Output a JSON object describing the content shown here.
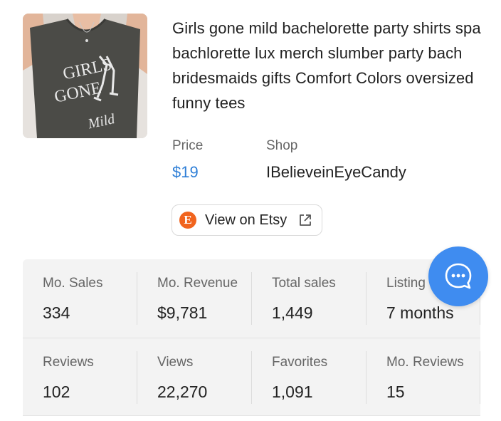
{
  "product": {
    "title": "Girls gone mild bachelorette party shirts spa bachlorette lux merch slumber party bach bridesmaids gifts Comfort Colors oversized funny tees",
    "image": {
      "print_line1": "GIRLS",
      "print_line2": "GONE",
      "print_script": "Mild"
    }
  },
  "meta": {
    "price_label": "Price",
    "price_value": "$19",
    "shop_label": "Shop",
    "shop_value": "IBelieveinEyeCandy"
  },
  "etsy_button": {
    "logo_letter": "E",
    "label": "View on Etsy",
    "icon": "external-link-icon"
  },
  "stats": {
    "row1": [
      {
        "label": "Mo. Sales",
        "value": "334"
      },
      {
        "label": "Mo. Revenue",
        "value": "$9,781"
      },
      {
        "label": "Total sales",
        "value": "1,449"
      },
      {
        "label": "Listing",
        "value": "7 months"
      }
    ],
    "row2": [
      {
        "label": "Reviews",
        "value": "102"
      },
      {
        "label": "Views",
        "value": "22,270"
      },
      {
        "label": "Favorites",
        "value": "1,091"
      },
      {
        "label": "Mo. Reviews",
        "value": "15"
      }
    ]
  },
  "chat": {
    "icon": "chat-bubble-icon"
  },
  "colors": {
    "accent": "#2f7fd7",
    "etsy": "#f1641e",
    "chat": "#3f8cf0",
    "stats_bg": "#f3f3f3"
  }
}
